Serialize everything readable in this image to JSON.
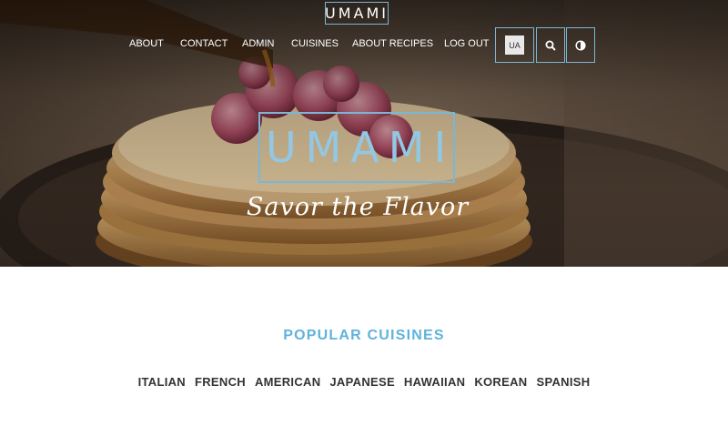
{
  "header": {
    "logo_text": "UMAMI"
  },
  "nav": {
    "links": [
      "ABOUT",
      "CONTACT",
      "ADMIN",
      "CUISINES",
      "ABOUT RECIPES",
      "LOG OUT"
    ],
    "language_label": "UA",
    "search_icon": "search-icon",
    "theme_icon": "contrast-icon"
  },
  "hero": {
    "brand": "UMAMI",
    "tagline": "Savor the Flavor"
  },
  "popular": {
    "title": "POPULAR CUISINES",
    "cuisines": [
      "ITALIAN",
      "FRENCH",
      "AMERICAN",
      "JAPANESE",
      "HAWAIIAN",
      "KOREAN",
      "SPANISH"
    ]
  },
  "colors": {
    "accent": "#5fb3dc",
    "border_accent": "#7bb6d6",
    "text_dark": "#333333"
  }
}
